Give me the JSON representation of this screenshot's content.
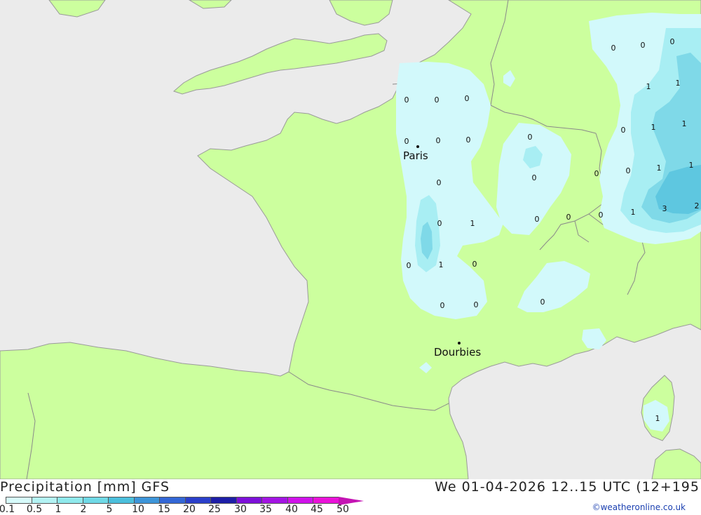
{
  "title": "Precipitation [mm] GFS",
  "datetime": "We 01-04-2026 12..15 UTC (12+195",
  "credit": "©weatheronline.co.uk",
  "colors": {
    "sea": "#ebebeb",
    "land": "#ccff9e",
    "border": "#8a8a8a",
    "precip_light": "#d2f9fb",
    "precip_mid": "#a8eef3",
    "precip_heavy": "#7fd9e8",
    "precip_strong": "#5ec7e0"
  },
  "legend": {
    "values": [
      "0.1",
      "0.5",
      "1",
      "2",
      "5",
      "10",
      "15",
      "20",
      "25",
      "30",
      "35",
      "40",
      "45",
      "50"
    ],
    "colors": [
      "#d7fbfb",
      "#b3f3f4",
      "#8fe9ec",
      "#6fd9e6",
      "#4bbfdc",
      "#3d95d9",
      "#3367d6",
      "#2a3fca",
      "#1d1ea7",
      "#7d10d9",
      "#a314e3",
      "#d012ea",
      "#ea12d9",
      "#c414b3"
    ]
  },
  "cities": [
    {
      "name": "Paris"
    },
    {
      "name": "Dourbies"
    }
  ],
  "value_labels": [
    "0",
    "0",
    "0",
    "0",
    "0",
    "0",
    "0",
    "0",
    "0",
    "0",
    "0",
    "1",
    "0",
    "1",
    "0",
    "0",
    "0",
    "0",
    "0",
    "0",
    "0",
    "0",
    "0",
    "0",
    "0",
    "0",
    "1",
    "1",
    "1",
    "1",
    "1",
    "1",
    "1",
    "3",
    "2",
    "1"
  ]
}
